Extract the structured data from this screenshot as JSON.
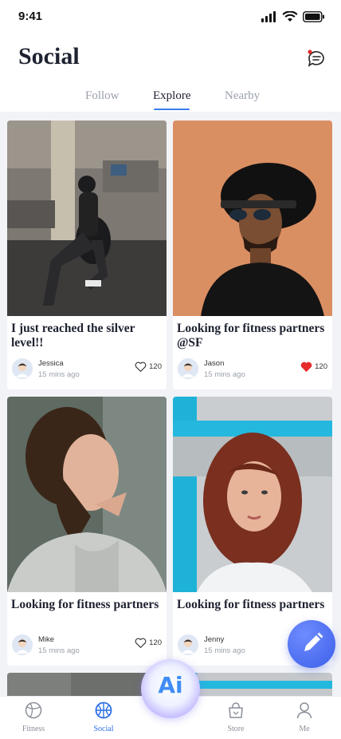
{
  "status_bar": {
    "time": "9:41"
  },
  "header": {
    "title": "Social",
    "tabs": [
      {
        "label": "Follow",
        "active": false
      },
      {
        "label": "Explore",
        "active": true
      },
      {
        "label": "Nearby",
        "active": false
      }
    ]
  },
  "feed": {
    "cards": [
      {
        "title": "I just reached the silver level!!",
        "author": "Jessica",
        "time": "15 mins ago",
        "likes": "120",
        "liked": false,
        "photo": "gym-photo"
      },
      {
        "title": "Looking for fitness partners @SF",
        "author": "Jason",
        "time": "15 mins ago",
        "likes": "120",
        "liked": true,
        "photo": "man-hat-photo"
      },
      {
        "title": "Looking for fitness partners",
        "author": "Mike",
        "time": "15 mins ago",
        "likes": "120",
        "liked": false,
        "photo": "man-curly-photo"
      },
      {
        "title": "Looking for fitness partners",
        "author": "Jenny",
        "time": "15 mins ago",
        "likes": "",
        "liked": false,
        "photo": "woman-photo"
      }
    ]
  },
  "fab": {
    "icon": "pencil-icon"
  },
  "ai_button": {
    "label": "Ai"
  },
  "bottom_nav": {
    "items": [
      {
        "label": "Fitness",
        "icon": "ball-icon",
        "active": false
      },
      {
        "label": "Social",
        "icon": "ball-icon",
        "active": true
      },
      {
        "label": "Store",
        "icon": "bag-icon",
        "active": false
      },
      {
        "label": "Me",
        "icon": "person-icon",
        "active": false
      }
    ]
  },
  "colors": {
    "accent": "#3a7ef0",
    "heart": "#e52b2b",
    "title": "#1e2230",
    "muted": "#9aa0aa"
  }
}
